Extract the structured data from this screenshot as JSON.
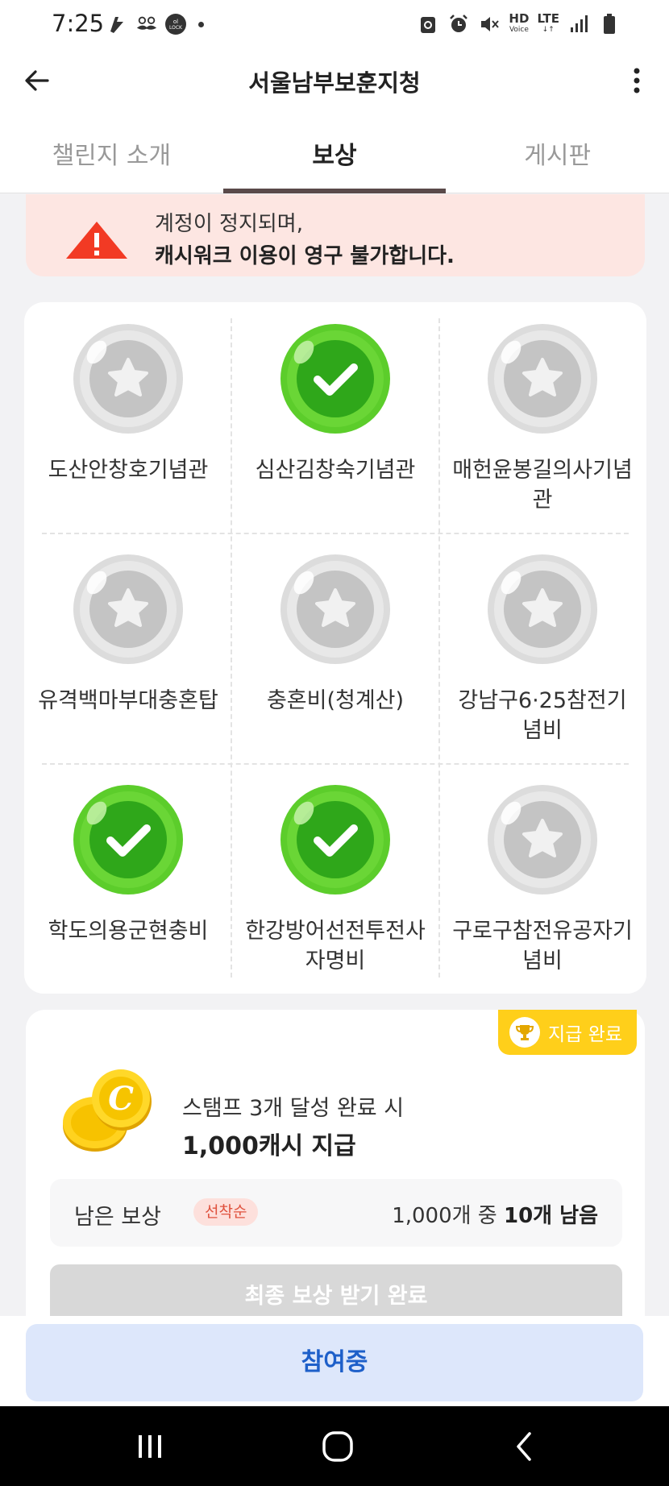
{
  "status_bar": {
    "time": "7:25",
    "left_icons": [
      "cashwalk-icon",
      "mustache-icon",
      "lock-screen-icon"
    ],
    "right_icons": [
      "recycle-icon",
      "alarm-icon",
      "mute-icon",
      "hd-voice-icon",
      "lte-icon",
      "signal-icon",
      "battery-icon"
    ],
    "hd_label": "HD",
    "hd_sub": "Voice",
    "lte_label": "LTE"
  },
  "app_bar": {
    "title": "서울남부보훈지청",
    "back_icon": "arrow-left-icon",
    "more_icon": "more-vertical-icon"
  },
  "tabs": [
    {
      "label": "챌린지 소개",
      "active": false
    },
    {
      "label": "보상",
      "active": true
    },
    {
      "label": "게시판",
      "active": false
    }
  ],
  "warning": {
    "line1": "계정이 정지되며,",
    "line2": "캐시워크 이용이 영구 불가합니다."
  },
  "stamps": [
    {
      "label": "도산안창호기념관",
      "done": false
    },
    {
      "label": "심산김창숙기념관",
      "done": true
    },
    {
      "label": "매헌윤봉길의사기념관",
      "done": false
    },
    {
      "label": "유격백마부대충혼탑",
      "done": false
    },
    {
      "label": "충혼비(청계산)",
      "done": false
    },
    {
      "label": "강남구6·25참전기념비",
      "done": false
    },
    {
      "label": "학도의용군현충비",
      "done": true
    },
    {
      "label": "한강방어선전투전사자명비",
      "done": true
    },
    {
      "label": "구로구참전유공자기념비",
      "done": false
    }
  ],
  "reward": {
    "badge": "지급 완료",
    "condition": "스탬프 3개 달성 완료 시",
    "amount": "1,000캐시 지급",
    "remain_label": "남은 보상",
    "first_come": "선착순",
    "remain_total": "1,000개 중",
    "remain_left": "10개 남음",
    "claim_button": "최종 보상 받기 완료"
  },
  "cta": {
    "label": "참여중"
  },
  "colors": {
    "accent_green": "#3fbf1f",
    "badge_yellow": "#ffcf1a",
    "cta_blue": "#1d5fc9",
    "warning_bg": "#fde6e2"
  }
}
